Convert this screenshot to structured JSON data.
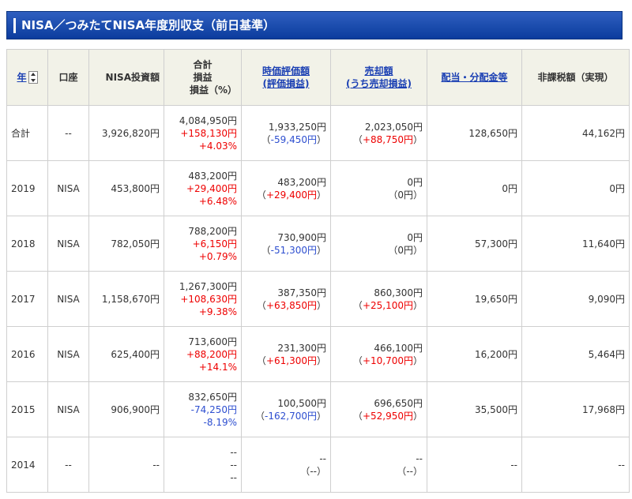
{
  "title": "NISA／つみたてNISA年度別収支（前日基準）",
  "headers": {
    "year": "年",
    "account": "口座",
    "invest": "NISA投資額",
    "total_line1": "合計",
    "total_line2": "損益",
    "total_line3": "損益（%）",
    "valuation_line1": "時価評価額",
    "valuation_line2": "(評価損益)",
    "sale_line1": "売却額",
    "sale_line2": "(うち売却損益)",
    "dividend": "配当・分配金等",
    "taxfree": "非課税額（実現）"
  },
  "rows": [
    {
      "year": "合計",
      "account": "--",
      "invest": "3,926,820円",
      "total": "4,084,950円",
      "pl": "+158,130円",
      "pct": "+4.03%",
      "val": "1,933,250円",
      "val_pl": "-59,450円",
      "sale": "2,023,050円",
      "sale_pl": "+88,750円",
      "div": "128,650円",
      "tax": "44,162円"
    },
    {
      "year": "2019",
      "account": "NISA",
      "invest": "453,800円",
      "total": "483,200円",
      "pl": "+29,400円",
      "pct": "+6.48%",
      "val": "483,200円",
      "val_pl": "+29,400円",
      "sale": "0円",
      "sale_pl": "0円",
      "div": "0円",
      "tax": "0円"
    },
    {
      "year": "2018",
      "account": "NISA",
      "invest": "782,050円",
      "total": "788,200円",
      "pl": "+6,150円",
      "pct": "+0.79%",
      "val": "730,900円",
      "val_pl": "-51,300円",
      "sale": "0円",
      "sale_pl": "0円",
      "div": "57,300円",
      "tax": "11,640円"
    },
    {
      "year": "2017",
      "account": "NISA",
      "invest": "1,158,670円",
      "total": "1,267,300円",
      "pl": "+108,630円",
      "pct": "+9.38%",
      "val": "387,350円",
      "val_pl": "+63,850円",
      "sale": "860,300円",
      "sale_pl": "+25,100円",
      "div": "19,650円",
      "tax": "9,090円"
    },
    {
      "year": "2016",
      "account": "NISA",
      "invest": "625,400円",
      "total": "713,600円",
      "pl": "+88,200円",
      "pct": "+14.1%",
      "val": "231,300円",
      "val_pl": "+61,300円",
      "sale": "466,100円",
      "sale_pl": "+10,700円",
      "div": "16,200円",
      "tax": "5,464円"
    },
    {
      "year": "2015",
      "account": "NISA",
      "invest": "906,900円",
      "total": "832,650円",
      "pl": "-74,250円",
      "pct": "-8.19%",
      "val": "100,500円",
      "val_pl": "-162,700円",
      "sale": "696,650円",
      "sale_pl": "+52,950円",
      "div": "35,500円",
      "tax": "17,968円"
    },
    {
      "year": "2014",
      "account": "--",
      "invest": "--",
      "total": "--",
      "pl": "--",
      "pct": "--",
      "val": "--",
      "val_pl": "--",
      "sale": "--",
      "sale_pl": "--",
      "div": "--",
      "tax": "--"
    }
  ],
  "colors": {
    "positive": "#ee0000",
    "negative": "#2e4fd0",
    "link": "#1a3fb3",
    "title_bg": "#1c4db0"
  }
}
